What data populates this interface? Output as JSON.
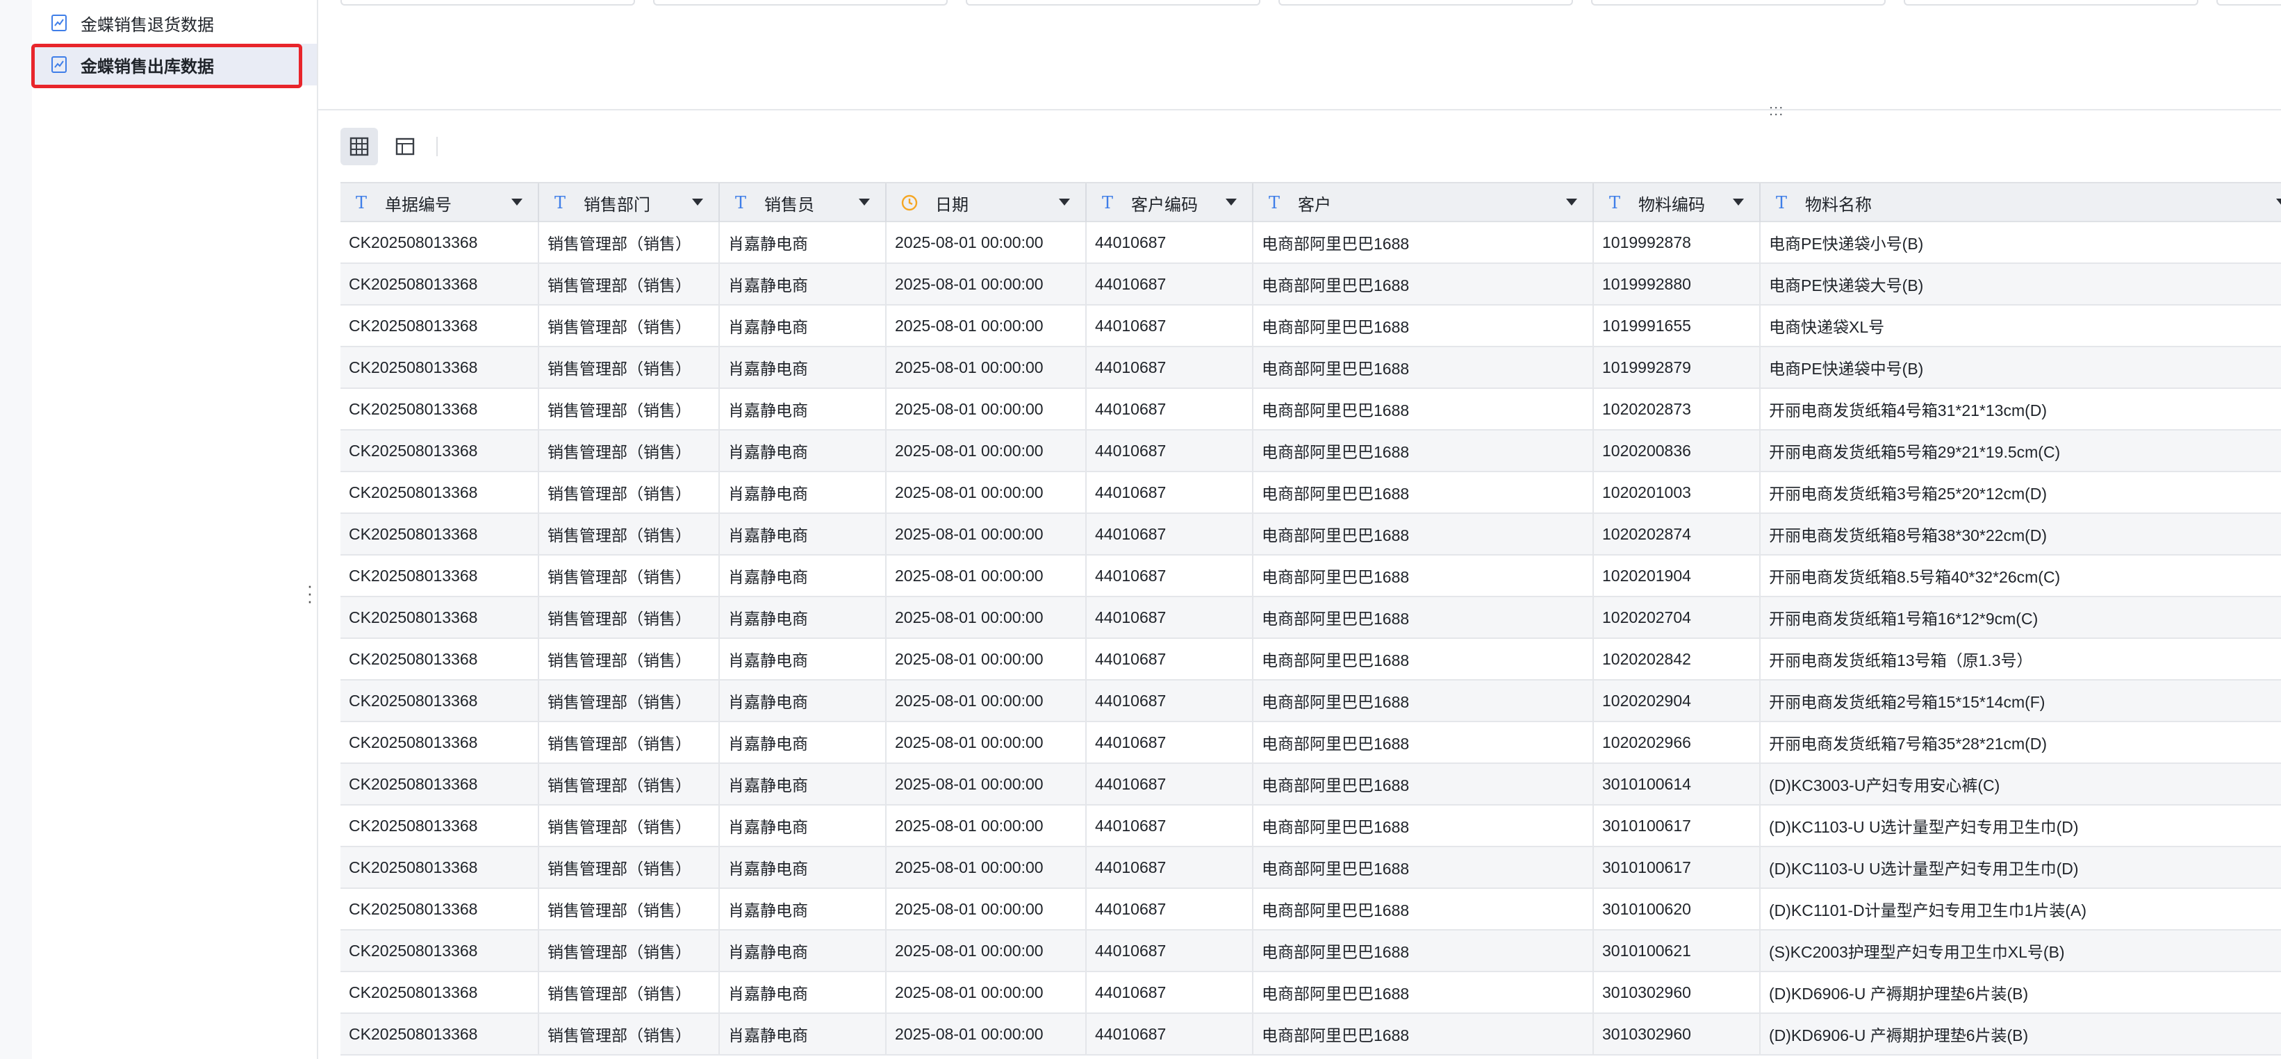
{
  "sidebar": {
    "items": [
      {
        "label": "金蝶销售退货数据",
        "active": false,
        "icon": "chart-file-icon"
      },
      {
        "label": "金蝶销售出库数据",
        "active": true,
        "icon": "chart-file-icon"
      }
    ]
  },
  "toolbar": {
    "views": [
      {
        "name": "grid-view-icon",
        "active": true
      },
      {
        "name": "layout-view-icon",
        "active": false
      }
    ]
  },
  "colors": {
    "accent": "#3f7ee8",
    "date_icon": "#f5a623",
    "highlight": "#e8252b"
  },
  "table": {
    "columns": [
      {
        "label": "单据编号",
        "type": "text"
      },
      {
        "label": "销售部门",
        "type": "text"
      },
      {
        "label": "销售员",
        "type": "text"
      },
      {
        "label": "日期",
        "type": "date"
      },
      {
        "label": "客户编码",
        "type": "text"
      },
      {
        "label": "客户",
        "type": "text"
      },
      {
        "label": "物料编码",
        "type": "text"
      },
      {
        "label": "物料名称",
        "type": "text"
      }
    ],
    "rows": [
      [
        "CK202508013368",
        "销售管理部（销售）",
        "肖嘉静电商",
        "2025-08-01 00:00:00",
        "44010687",
        "电商部阿里巴巴1688",
        "1019992878",
        "电商PE快递袋小号(B)"
      ],
      [
        "CK202508013368",
        "销售管理部（销售）",
        "肖嘉静电商",
        "2025-08-01 00:00:00",
        "44010687",
        "电商部阿里巴巴1688",
        "1019992880",
        "电商PE快递袋大号(B)"
      ],
      [
        "CK202508013368",
        "销售管理部（销售）",
        "肖嘉静电商",
        "2025-08-01 00:00:00",
        "44010687",
        "电商部阿里巴巴1688",
        "1019991655",
        "电商快递袋XL号"
      ],
      [
        "CK202508013368",
        "销售管理部（销售）",
        "肖嘉静电商",
        "2025-08-01 00:00:00",
        "44010687",
        "电商部阿里巴巴1688",
        "1019992879",
        "电商PE快递袋中号(B)"
      ],
      [
        "CK202508013368",
        "销售管理部（销售）",
        "肖嘉静电商",
        "2025-08-01 00:00:00",
        "44010687",
        "电商部阿里巴巴1688",
        "1020202873",
        "开丽电商发货纸箱4号箱31*21*13cm(D)"
      ],
      [
        "CK202508013368",
        "销售管理部（销售）",
        "肖嘉静电商",
        "2025-08-01 00:00:00",
        "44010687",
        "电商部阿里巴巴1688",
        "1020200836",
        "开丽电商发货纸箱5号箱29*21*19.5cm(C)"
      ],
      [
        "CK202508013368",
        "销售管理部（销售）",
        "肖嘉静电商",
        "2025-08-01 00:00:00",
        "44010687",
        "电商部阿里巴巴1688",
        "1020201003",
        "开丽电商发货纸箱3号箱25*20*12cm(D)"
      ],
      [
        "CK202508013368",
        "销售管理部（销售）",
        "肖嘉静电商",
        "2025-08-01 00:00:00",
        "44010687",
        "电商部阿里巴巴1688",
        "1020202874",
        "开丽电商发货纸箱8号箱38*30*22cm(D)"
      ],
      [
        "CK202508013368",
        "销售管理部（销售）",
        "肖嘉静电商",
        "2025-08-01 00:00:00",
        "44010687",
        "电商部阿里巴巴1688",
        "1020201904",
        "开丽电商发货纸箱8.5号箱40*32*26cm(C)"
      ],
      [
        "CK202508013368",
        "销售管理部（销售）",
        "肖嘉静电商",
        "2025-08-01 00:00:00",
        "44010687",
        "电商部阿里巴巴1688",
        "1020202704",
        "开丽电商发货纸箱1号箱16*12*9cm(C)"
      ],
      [
        "CK202508013368",
        "销售管理部（销售）",
        "肖嘉静电商",
        "2025-08-01 00:00:00",
        "44010687",
        "电商部阿里巴巴1688",
        "1020202842",
        "开丽电商发货纸箱13号箱（原1.3号）"
      ],
      [
        "CK202508013368",
        "销售管理部（销售）",
        "肖嘉静电商",
        "2025-08-01 00:00:00",
        "44010687",
        "电商部阿里巴巴1688",
        "1020202904",
        "开丽电商发货纸箱2号箱15*15*14cm(F)"
      ],
      [
        "CK202508013368",
        "销售管理部（销售）",
        "肖嘉静电商",
        "2025-08-01 00:00:00",
        "44010687",
        "电商部阿里巴巴1688",
        "1020202966",
        "开丽电商发货纸箱7号箱35*28*21cm(D)"
      ],
      [
        "CK202508013368",
        "销售管理部（销售）",
        "肖嘉静电商",
        "2025-08-01 00:00:00",
        "44010687",
        "电商部阿里巴巴1688",
        "3010100614",
        "(D)KC3003-U产妇专用安心裤(C)"
      ],
      [
        "CK202508013368",
        "销售管理部（销售）",
        "肖嘉静电商",
        "2025-08-01 00:00:00",
        "44010687",
        "电商部阿里巴巴1688",
        "3010100617",
        "(D)KC1103-U U选计量型产妇专用卫生巾(D)"
      ],
      [
        "CK202508013368",
        "销售管理部（销售）",
        "肖嘉静电商",
        "2025-08-01 00:00:00",
        "44010687",
        "电商部阿里巴巴1688",
        "3010100617",
        "(D)KC1103-U U选计量型产妇专用卫生巾(D)"
      ],
      [
        "CK202508013368",
        "销售管理部（销售）",
        "肖嘉静电商",
        "2025-08-01 00:00:00",
        "44010687",
        "电商部阿里巴巴1688",
        "3010100620",
        "(D)KC1101-D计量型产妇专用卫生巾1片装(A)"
      ],
      [
        "CK202508013368",
        "销售管理部（销售）",
        "肖嘉静电商",
        "2025-08-01 00:00:00",
        "44010687",
        "电商部阿里巴巴1688",
        "3010100621",
        "(S)KC2003护理型产妇专用卫生巾XL号(B)"
      ],
      [
        "CK202508013368",
        "销售管理部（销售）",
        "肖嘉静电商",
        "2025-08-01 00:00:00",
        "44010687",
        "电商部阿里巴巴1688",
        "3010302960",
        "(D)KD6906-U 产褥期护理垫6片装(B)"
      ],
      [
        "CK202508013368",
        "销售管理部（销售）",
        "肖嘉静电商",
        "2025-08-01 00:00:00",
        "44010687",
        "电商部阿里巴巴1688",
        "3010302960",
        "(D)KD6906-U 产褥期护理垫6片装(B)"
      ]
    ]
  }
}
